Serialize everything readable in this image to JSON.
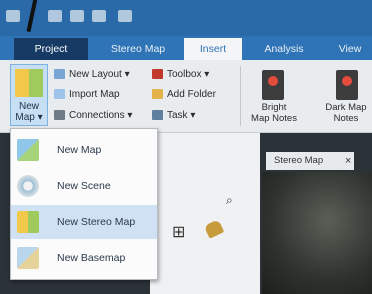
{
  "quick_access": {
    "icons": [
      "save-icon",
      "open-icon",
      "undo-icon",
      "redo-icon",
      "customize-icon"
    ]
  },
  "tabs": [
    {
      "label": "Project"
    },
    {
      "label": "Stereo Map"
    },
    {
      "label": "Insert"
    },
    {
      "label": "Analysis"
    },
    {
      "label": "View"
    }
  ],
  "ribbon": {
    "new_map": "New\nMap ▾",
    "new_layout": "New Layout ▾",
    "import_map": "Import Map",
    "connections": "Connections ▾",
    "toolbox": "Toolbox ▾",
    "add_folder": "Add Folder",
    "task": "Task ▾",
    "bright_notes": "Bright\nMap Notes",
    "dark_notes": "Dark Map\nNotes"
  },
  "dropdown": {
    "items": [
      {
        "label": "New Map"
      },
      {
        "label": "New Scene"
      },
      {
        "label": "New Stereo Map"
      },
      {
        "label": "New Basemap"
      }
    ]
  },
  "view_tab": {
    "label": "Stereo Map",
    "close": "×"
  },
  "colors": {
    "ribbon_blue": "#2f74b6",
    "highlight": "#cfe1f3"
  }
}
